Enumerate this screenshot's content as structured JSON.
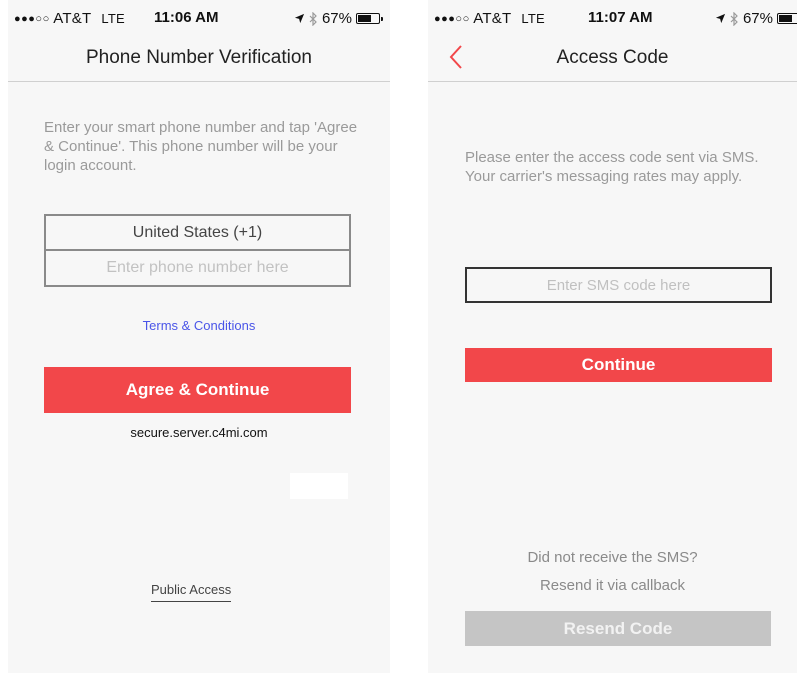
{
  "left_screen": {
    "status": {
      "carrier": "AT&T",
      "network": "LTE",
      "time": "11:06 AM",
      "battery": "67%",
      "battery_level": 0.67
    },
    "title": "Phone Number Verification",
    "instructions": "Enter your smart phone number and tap 'Agree & Continue'. This phone number will be your login account.",
    "country": "United States (+1)",
    "phone_placeholder": "Enter phone number here",
    "phone_value": "",
    "terms_link": "Terms & Conditions",
    "agree_button": "Agree & Continue",
    "server": "secure.server.c4mi.com",
    "public_access": "Public Access"
  },
  "right_screen": {
    "status": {
      "carrier": "AT&T",
      "network": "LTE",
      "time": "11:07 AM",
      "battery": "67%",
      "battery_level": 0.67
    },
    "title": "Access Code",
    "instructions_line1": "Please enter the access code sent via SMS.",
    "instructions_line2": "Your carrier's messaging rates may apply.",
    "sms_placeholder": "Enter SMS code here",
    "sms_value": "",
    "continue_button": "Continue",
    "not_received": "Did not receive the SMS?",
    "resend_hint": "Resend it via callback",
    "resend_button": "Resend Code"
  },
  "colors": {
    "accent_red": "#f2474a",
    "link_blue": "#4a55e8",
    "disabled_gray": "#c5c5c5"
  },
  "icons": [
    "signal-dots-icon",
    "location-arrow-icon",
    "bluetooth-icon",
    "battery-icon",
    "back-chevron-icon"
  ]
}
